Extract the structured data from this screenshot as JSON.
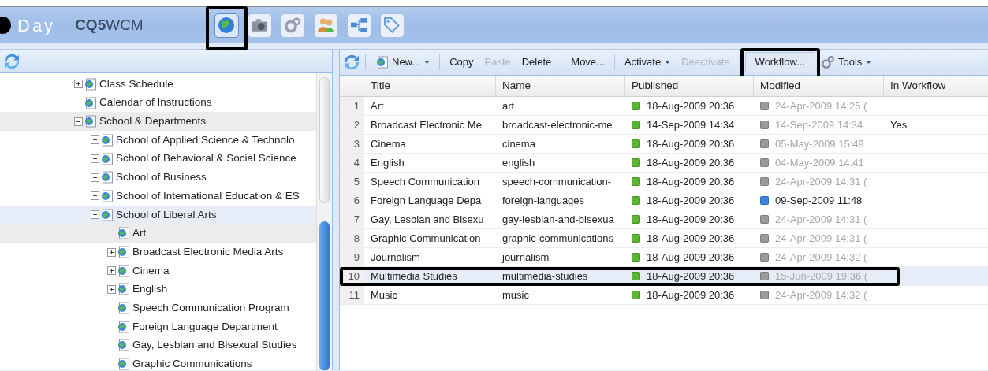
{
  "header": {
    "logo": "Day",
    "product_bold": "CQ5",
    "product": "WCM",
    "apps": [
      {
        "kind": "globe",
        "selected": true,
        "boxed": true
      },
      {
        "kind": "camera",
        "selected": false,
        "boxed": false
      },
      {
        "kind": "gears",
        "selected": false,
        "boxed": false
      },
      {
        "kind": "users",
        "selected": false,
        "boxed": false
      },
      {
        "kind": "tree",
        "selected": false,
        "boxed": false
      },
      {
        "kind": "tag",
        "selected": false,
        "boxed": false
      }
    ]
  },
  "tree": {
    "items": [
      {
        "label": "Class Schedule",
        "kind": "folder",
        "expanded": false,
        "selected": false,
        "hovered": false
      },
      {
        "label": "Calendar of Instructions",
        "kind": "page",
        "selected": false,
        "hovered": false
      },
      {
        "label": "School & Departments",
        "kind": "folder",
        "expanded": true,
        "selected": false,
        "hovered": true,
        "children": [
          {
            "label": "School of Applied Science & Technolo",
            "kind": "folder",
            "expanded": false,
            "selected": false,
            "hovered": false
          },
          {
            "label": "School of Behavioral & Social Science",
            "kind": "folder",
            "expanded": false,
            "selected": false,
            "hovered": false
          },
          {
            "label": "School of Business",
            "kind": "folder",
            "expanded": false,
            "selected": false,
            "hovered": false
          },
          {
            "label": "School of International Education & ES",
            "kind": "folder",
            "expanded": false,
            "selected": false,
            "hovered": false
          },
          {
            "label": "School of Liberal Arts",
            "kind": "folder",
            "expanded": true,
            "selected": true,
            "hovered": false,
            "children": [
              {
                "label": "Art",
                "kind": "page",
                "selected": false,
                "hovered": true
              },
              {
                "label": "Broadcast Electronic Media Arts",
                "kind": "folder",
                "expanded": false,
                "selected": false,
                "hovered": false
              },
              {
                "label": "Cinema",
                "kind": "folder",
                "expanded": false,
                "selected": false,
                "hovered": false
              },
              {
                "label": "English",
                "kind": "folder",
                "expanded": false,
                "selected": false,
                "hovered": false
              },
              {
                "label": "Speech Communication Program",
                "kind": "page",
                "selected": false,
                "hovered": false
              },
              {
                "label": "Foreign Language Department",
                "kind": "page",
                "selected": false,
                "hovered": false
              },
              {
                "label": "Gay, Lesbian and Bisexual Studies",
                "kind": "page",
                "selected": false,
                "hovered": false
              },
              {
                "label": "Graphic Communications",
                "kind": "page",
                "selected": false,
                "hovered": false
              }
            ]
          }
        ]
      }
    ]
  },
  "toolbar": [
    {
      "label": "New...",
      "kind": "menu",
      "disabled": false,
      "boxed": false
    },
    {
      "kind": "separator"
    },
    {
      "label": "Copy",
      "kind": "button",
      "disabled": false,
      "boxed": false
    },
    {
      "label": "Paste",
      "kind": "button",
      "disabled": true,
      "boxed": false
    },
    {
      "label": "Delete",
      "kind": "button",
      "disabled": false,
      "boxed": false
    },
    {
      "kind": "separator"
    },
    {
      "label": "Move...",
      "kind": "button",
      "disabled": false,
      "boxed": false
    },
    {
      "kind": "separator"
    },
    {
      "label": "Activate",
      "kind": "menu-plain",
      "disabled": false,
      "boxed": false
    },
    {
      "label": "Deactivate",
      "kind": "button",
      "disabled": true,
      "boxed": false
    },
    {
      "kind": "separator"
    },
    {
      "label": "Workflow...",
      "kind": "button",
      "disabled": false,
      "boxed": true
    },
    {
      "label": "Tools",
      "kind": "tools",
      "disabled": false,
      "boxed": false
    }
  ],
  "table": {
    "columns": [
      "Title",
      "Name",
      "Published",
      "Modified",
      "In Workflow"
    ],
    "rows": [
      {
        "number": "1",
        "title": "Art",
        "name": "art",
        "published": {
          "date": "18-Aug-2009 20:36",
          "color": "#5bb531"
        },
        "modified": {
          "date": "24-Apr-2009 14:25 (",
          "color": "#9a9a9a",
          "dimmed": true
        },
        "in_workflow": "",
        "selected": false,
        "boxed": false
      },
      {
        "number": "2",
        "title": "Broadcast Electronic Me",
        "name": "broadcast-electronic-me",
        "published": {
          "date": "14-Sep-2009 14:34",
          "color": "#5bb531"
        },
        "modified": {
          "date": "14-Sep-2009 14:34",
          "color": "#9a9a9a",
          "dimmed": true
        },
        "in_workflow": "Yes",
        "selected": false,
        "boxed": false
      },
      {
        "number": "3",
        "title": "Cinema",
        "name": "cinema",
        "published": {
          "date": "18-Aug-2009 20:36",
          "color": "#5bb531"
        },
        "modified": {
          "date": "05-May-2009 15:49",
          "color": "#9a9a9a",
          "dimmed": true
        },
        "in_workflow": "",
        "selected": false,
        "boxed": false
      },
      {
        "number": "4",
        "title": "English",
        "name": "english",
        "published": {
          "date": "18-Aug-2009 20:36",
          "color": "#5bb531"
        },
        "modified": {
          "date": "04-May-2009 14:41",
          "color": "#9a9a9a",
          "dimmed": true
        },
        "in_workflow": "",
        "selected": false,
        "boxed": false
      },
      {
        "number": "5",
        "title": "Speech Communication",
        "name": "speech-communication-",
        "published": {
          "date": "18-Aug-2009 20:36",
          "color": "#5bb531"
        },
        "modified": {
          "date": "24-Apr-2009 14:31 (",
          "color": "#9a9a9a",
          "dimmed": true
        },
        "in_workflow": "",
        "selected": false,
        "boxed": false
      },
      {
        "number": "6",
        "title": "Foreign Language Depa",
        "name": "foreign-languages",
        "published": {
          "date": "18-Aug-2009 20:36",
          "color": "#5bb531"
        },
        "modified": {
          "date": "09-Sep-2009 11:48",
          "color": "#3a86e0",
          "dimmed": false
        },
        "in_workflow": "",
        "selected": false,
        "boxed": false
      },
      {
        "number": "7",
        "title": "Gay, Lesbian and Bisexu",
        "name": "gay-lesbian-and-bisexua",
        "published": {
          "date": "18-Aug-2009 20:36",
          "color": "#5bb531"
        },
        "modified": {
          "date": "24-Apr-2009 14:31 (",
          "color": "#9a9a9a",
          "dimmed": true
        },
        "in_workflow": "",
        "selected": false,
        "boxed": false
      },
      {
        "number": "8",
        "title": "Graphic Communication",
        "name": "graphic-communications",
        "published": {
          "date": "18-Aug-2009 20:36",
          "color": "#5bb531"
        },
        "modified": {
          "date": "24-Apr-2009 14:31 (",
          "color": "#9a9a9a",
          "dimmed": true
        },
        "in_workflow": "",
        "selected": false,
        "boxed": false
      },
      {
        "number": "9",
        "title": "Journalism",
        "name": "journalism",
        "published": {
          "date": "18-Aug-2009 20:36",
          "color": "#5bb531"
        },
        "modified": {
          "date": "24-Apr-2009 14:32 (",
          "color": "#9a9a9a",
          "dimmed": true
        },
        "in_workflow": "",
        "selected": false,
        "boxed": false
      },
      {
        "number": "10",
        "title": "Multimedia Studies",
        "name": "multimedia-studies",
        "published": {
          "date": "18-Aug-2009 20:36",
          "color": "#5bb531"
        },
        "modified": {
          "date": "15-Jun-2009 19:36 (",
          "color": "#9a9a9a",
          "dimmed": true
        },
        "in_workflow": "",
        "selected": true,
        "boxed": true
      },
      {
        "number": "11",
        "title": "Music",
        "name": "music",
        "published": {
          "date": "18-Aug-2009 20:36",
          "color": "#5bb531"
        },
        "modified": {
          "date": "24-Apr-2009 14:32 (",
          "color": "#9a9a9a",
          "dimmed": true
        },
        "in_workflow": "",
        "selected": false,
        "boxed": false
      }
    ]
  }
}
